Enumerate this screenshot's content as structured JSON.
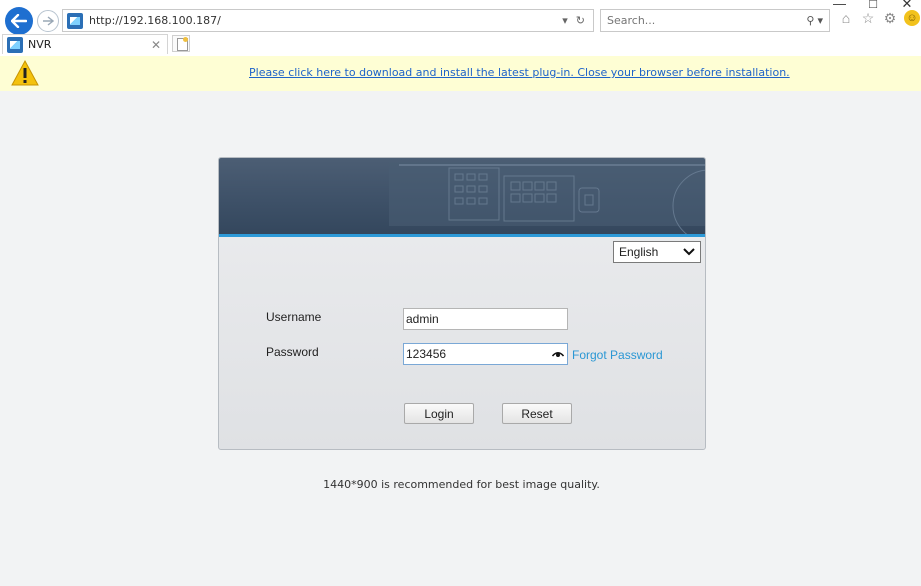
{
  "browser": {
    "url": "http://192.168.100.187/",
    "search_placeholder": "Search...",
    "tab_title": "NVR",
    "window_controls": {
      "minimize": "—",
      "maximize": "□",
      "close": "✕"
    }
  },
  "infobar": {
    "message": "Please click here to download and install the latest plug-in. Close your browser before installation."
  },
  "login": {
    "language": "English",
    "username_label": "Username",
    "username_value": "admin",
    "password_label": "Password",
    "password_value": "123456",
    "forgot_label": "Forgot Password",
    "login_label": "Login",
    "reset_label": "Reset"
  },
  "hint": "1440*900 is recommended for best image quality.",
  "colors": {
    "accent": "#2a97d4",
    "banner": "#3d5067",
    "infobar": "#fefed4",
    "link": "#1e63c9"
  }
}
